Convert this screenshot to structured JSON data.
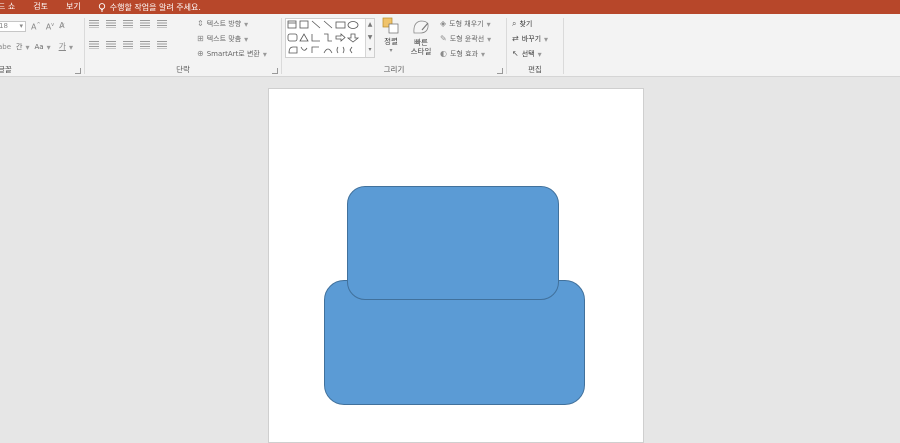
{
  "tabs": [
    "드 쇼",
    "검토",
    "보기"
  ],
  "tell_me": "수행할 작업을 알려 주세요.",
  "colors": {
    "tabbar": "#b7472a",
    "ribbon": "#f3f3f3",
    "workspace": "#e6e6e6",
    "shape_fill": "#5b9bd5",
    "shape_border": "#41719c"
  },
  "font_group": {
    "label": "글꼴",
    "font_size": "18",
    "case_label": "Aa",
    "spacing_label": "간"
  },
  "paragraph_group": {
    "label": "단락",
    "text_direction": "텍스트 방향",
    "align_text": "텍스트 맞춤",
    "smartart": "SmartArt로 변환"
  },
  "drawing_group": {
    "label": "그리기",
    "arrange": "정렬",
    "quick_styles_line1": "빠른",
    "quick_styles_line2": "스타일",
    "shape_fill": "도형 채우기",
    "shape_outline": "도형 윤곽선",
    "shape_effects": "도형 효과"
  },
  "editing_group": {
    "label": "편집",
    "find": "찾기",
    "replace": "바꾸기",
    "select": "선택"
  }
}
